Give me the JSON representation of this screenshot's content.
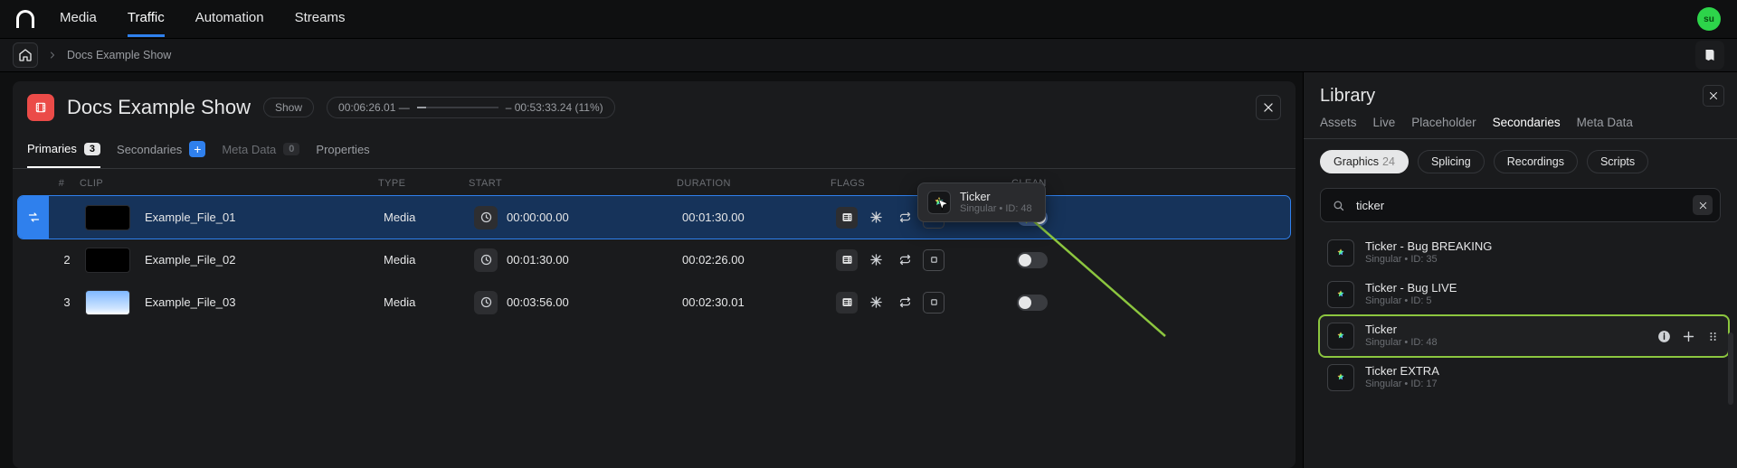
{
  "nav": {
    "items": [
      "Media",
      "Traffic",
      "Automation",
      "Streams"
    ],
    "active_index": 1,
    "user_initials": "su"
  },
  "breadcrumb": {
    "current": "Docs Example Show"
  },
  "show": {
    "title": "Docs Example Show",
    "type_badge": "Show",
    "time_left": "00:06:26.01 —",
    "time_right": "– 00:53:33.24 (11%)"
  },
  "subtabs": {
    "primaries": {
      "label": "Primaries",
      "count": "3"
    },
    "secondaries": {
      "label": "Secondaries"
    },
    "metadata": {
      "label": "Meta Data",
      "count": "0"
    },
    "properties": {
      "label": "Properties"
    }
  },
  "columns": {
    "num": "#",
    "clip": "CLIP",
    "type": "TYPE",
    "start": "START",
    "duration": "DURATION",
    "flags": "FLAGS",
    "clean": "CLEAN"
  },
  "rows": [
    {
      "num": "",
      "clip": "Example_File_01",
      "type": "Media",
      "start": "00:00:00.00",
      "duration": "00:01:30.00",
      "clean_on": true,
      "thumb": "black",
      "selected": true
    },
    {
      "num": "2",
      "clip": "Example_File_02",
      "type": "Media",
      "start": "00:01:30.00",
      "duration": "00:02:26.00",
      "clean_on": false,
      "thumb": "black",
      "selected": false
    },
    {
      "num": "3",
      "clip": "Example_File_03",
      "type": "Media",
      "start": "00:03:56.00",
      "duration": "00:02:30.01",
      "clean_on": false,
      "thumb": "sky",
      "selected": false
    }
  ],
  "drag_tip": {
    "title": "Ticker",
    "sub": "Singular • ID: 48"
  },
  "library": {
    "title": "Library",
    "tabs": [
      "Assets",
      "Live",
      "Placeholder",
      "Secondaries",
      "Meta Data"
    ],
    "active_tab_index": 3,
    "chips": [
      {
        "label": "Graphics",
        "count": "24",
        "active": true
      },
      {
        "label": "Splicing",
        "active": false
      },
      {
        "label": "Recordings",
        "active": false
      },
      {
        "label": "Scripts",
        "active": false
      }
    ],
    "search_value": "ticker",
    "items": [
      {
        "name": "Ticker - Bug BREAKING",
        "sub": "Singular • ID: 35",
        "hl": false
      },
      {
        "name": "Ticker - Bug LIVE",
        "sub": "Singular • ID: 5",
        "hl": false
      },
      {
        "name": "Ticker",
        "sub": "Singular • ID: 48",
        "hl": true
      },
      {
        "name": "Ticker EXTRA",
        "sub": "Singular • ID: 17",
        "hl": false
      }
    ]
  }
}
